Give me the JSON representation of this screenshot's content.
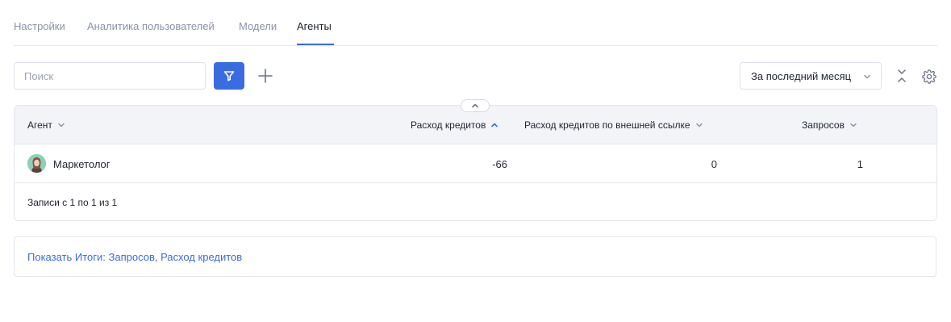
{
  "tabs": [
    {
      "label": "Настройки"
    },
    {
      "label": "Аналитика пользователей"
    },
    {
      "label": "Модели"
    },
    {
      "label": "Агенты",
      "active": true
    }
  ],
  "toolbar": {
    "search_placeholder": "Поиск",
    "search_value": "",
    "filter_icon": "filter-icon",
    "add_icon": "plus-icon",
    "period_label": "За последний месяц",
    "collapse_icon": "collapse-icon",
    "settings_icon": "gear-icon"
  },
  "table": {
    "columns": [
      {
        "label": "Агент",
        "sort": "none"
      },
      {
        "label": "Расход кредитов",
        "sort": "asc"
      },
      {
        "label": "Расход кредитов по внешней ссылке",
        "sort": "none"
      },
      {
        "label": "Запросов",
        "sort": "none"
      }
    ],
    "rows": [
      {
        "agent": "Маркетолог",
        "credits": "-66",
        "external_credits": "0",
        "requests": "1"
      }
    ],
    "footer": "Записи с 1 по 1 из 1"
  },
  "summary": {
    "link_label": "Показать Итоги: Запросов, Расход кредитов"
  },
  "colors": {
    "accent": "#3b6be0",
    "muted_text": "#8a93a6",
    "header_bg": "#f2f4f8",
    "border": "#e3e6ee"
  }
}
